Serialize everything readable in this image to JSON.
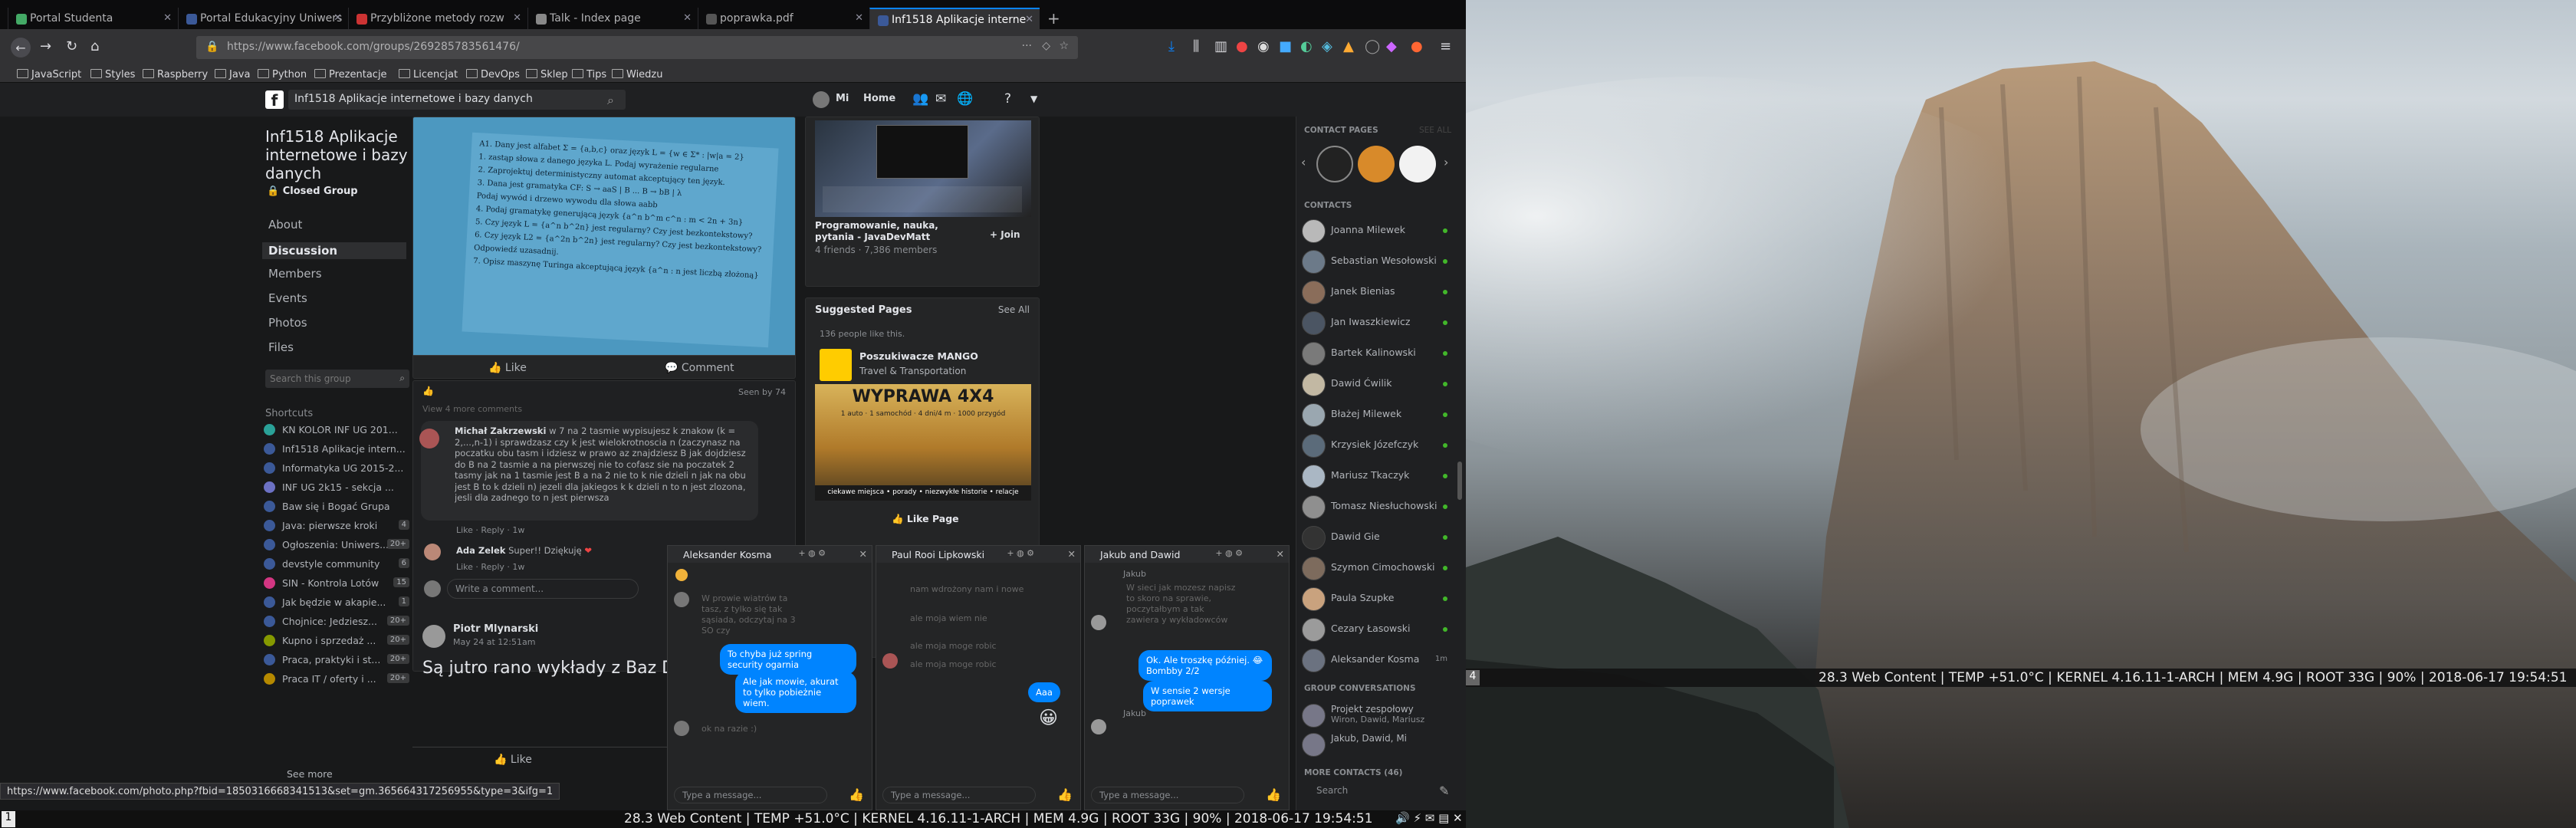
{
  "browser": {
    "tabs": [
      {
        "label": "Portal Studenta",
        "active": false
      },
      {
        "label": "Portal Edukacyjny Uniwers",
        "active": false
      },
      {
        "label": "Przybliżone metody rozw",
        "active": false
      },
      {
        "label": "Talk - Index page",
        "active": false
      },
      {
        "label": "poprawka.pdf",
        "active": false
      },
      {
        "label": "Inf1518 Aplikacje interne",
        "active": true
      }
    ],
    "new_tab": "+",
    "url": "https://www.facebook.com/groups/269285783561476/",
    "bookmarks": [
      "JavaScript",
      "Styles",
      "Raspberry",
      "Java",
      "Python",
      "Prezentacje",
      "Licencjat",
      "DevOps",
      "Sklep",
      "Tips",
      "Wiedzu"
    ],
    "hover_url": "https://www.facebook.com/photo.php?fbid=1850316668341513&set=gm.365664317256955&type=3&ifg=1"
  },
  "fb_top": {
    "group_name": "Inf1518 Aplikacje internetowe i bazy danych",
    "user": "Mi",
    "home": "Home"
  },
  "group": {
    "title": "Inf1518 Aplikacje internetowe i bazy danych",
    "privacy": "Closed Group",
    "nav": [
      "About",
      "Discussion",
      "Members",
      "Events",
      "Photos",
      "Files"
    ],
    "search_placeholder": "Search this group",
    "shortcuts_title": "Shortcuts",
    "shortcuts": [
      {
        "label": "KN KOLOR INF UG 201...",
        "badge": ""
      },
      {
        "label": "Inf1518 Aplikacje intern...",
        "badge": ""
      },
      {
        "label": "Informatyka UG 2015-2...",
        "badge": ""
      },
      {
        "label": "INF UG 2k15 - sekcja ...",
        "badge": ""
      },
      {
        "label": "Baw się i Bogać Grupa",
        "badge": ""
      },
      {
        "label": "Java: pierwsze kroki",
        "badge": "4"
      },
      {
        "label": "Ogłoszenia: Uniwers...",
        "badge": "20+"
      },
      {
        "label": "devstyle community",
        "badge": "6"
      },
      {
        "label": "SIN - Kontrola Lotów",
        "badge": "15"
      },
      {
        "label": "Jak będzie w akapie...",
        "badge": "1"
      },
      {
        "label": "Chojnice: Jedziesz...",
        "badge": "20+"
      },
      {
        "label": "Kupno i sprzedaż ...",
        "badge": "20+"
      },
      {
        "label": "Praca, praktyki i st...",
        "badge": "20+"
      },
      {
        "label": "Praca IT / oferty i ...",
        "badge": "20+"
      }
    ],
    "see_more": "See more"
  },
  "post": {
    "like_label": "Like",
    "comment_label": "Comment",
    "seen_by": "Seen by 74",
    "view_comments": "View 4 more comments",
    "comment1_author": "Michał Zakrzewski",
    "comment1_text": "w 7 na 2 tasmie wypisujesz k znakow (k = 2,...,n-1) i sprawdzasz czy k jest wielokrotnoscia n (zaczynasz na poczatku obu tasm i idziesz w prawo az znajdziesz B jak dojdziesz do B na 2 tasmie a na pierwszej nie to cofasz sie na poczatek 2 tasmy jak na 1 tasmie jest B a na 2 nie to k nie dzieli n jak na obu jest B to k dzieli n) jezeli dla jakiegos k k dzieli n to n jest zlozona, jesli dla zadnego to n jest pierwsza",
    "comment1_actions": "Like · Reply · 1w",
    "comment2_author": "Ada Zelek",
    "comment2_text": "Super!! Dziękuję",
    "comment2_actions": "Like · Reply · 1w",
    "write_comment": "Write a comment...",
    "post2_author": "Piotr Mlynarski",
    "post2_date": "May 24 at 12:51am",
    "post2_text": "Są jutro rano wykłady z Baz D",
    "post2_like": "Like"
  },
  "worksheet_lines": [
    "A1. Dany jest alfabet Σ = {a,b,c} oraz język L = {w ∈ Σ* : |w|a = 2}",
    "1. zastąp słowa z danego języka L. Podaj wyrażenie regularne",
    "2. Zaprojektuj deterministyczny automat akceptujący ten język.",
    "3. Dana jest gramatyka CF: S → aaS | B ... B → bB | λ",
    "Podaj wywód i drzewo wywodu dla słowa aabb",
    "4. Podaj gramatykę generującą język {a^n b^m c^n : m < 2n + 3n}",
    "5. Czy język L = {a^n b^2n} jest regularny? Czy jest bezkontekstowy?",
    "6. Czy język L2 = {a^2n b^2n} jest regularny? Czy jest bezkontekstowy?",
    "Odpowiedź uzasadnij.",
    "7. Opisz maszynę Turinga akceptującą język {a^n : n jest liczbą złożoną}"
  ],
  "right_col": {
    "page_name": "Programowanie, nauka, pytania - JavaDevMatt",
    "page_meta": "4 friends · 7,386 members",
    "join": "Join",
    "suggested_title": "Suggested Pages",
    "see_all": "See All",
    "likes_count": "136 people like this.",
    "suggested_page_name": "Poszukiwacze MANGO",
    "suggested_page_cat": "Travel & Transportation",
    "ad_title": "WYPRAWA 4X4",
    "ad_sub": "1 auto · 1 samochód · 4 dni/4 m · 1000 przygód",
    "ad_footer": "ciekawe miejsca • porady • niezwykłe historie • relacje",
    "like_page": "Like Page"
  },
  "contacts": {
    "pages_title": "CONTACT PAGES",
    "see_all": "SEE ALL",
    "contacts_title": "CONTACTS",
    "list": [
      {
        "name": "Joanna Milewek",
        "status": "online"
      },
      {
        "name": "Sebastian Wesołowski",
        "status": "online"
      },
      {
        "name": "Janek Bienias",
        "status": "online"
      },
      {
        "name": "Jan Iwaszkiewicz",
        "status": "online"
      },
      {
        "name": "Bartek Kalinowski",
        "status": "online"
      },
      {
        "name": "Dawid Ćwilik",
        "status": "online"
      },
      {
        "name": "Błażej Milewek",
        "status": "online"
      },
      {
        "name": "Krzysiek Józefczyk",
        "status": "online"
      },
      {
        "name": "Mariusz Tkaczyk",
        "status": "online"
      },
      {
        "name": "Tomasz Niesłuchowski",
        "status": "online"
      },
      {
        "name": "Dawid Gie",
        "status": "online"
      },
      {
        "name": "Szymon Cimochowski",
        "status": "online"
      },
      {
        "name": "Paula Szupke",
        "status": "online"
      },
      {
        "name": "Cezary Łasowski",
        "status": "online"
      },
      {
        "name": "Aleksander Kosma",
        "status": "1m"
      }
    ],
    "group_conv_title": "GROUP CONVERSATIONS",
    "groups": [
      {
        "name": "Projekt zespołowy",
        "sub": "Wiron, Dawid, Mariusz"
      },
      {
        "name": "Jakub, Dawid, Mi",
        "sub": ""
      }
    ],
    "more_contacts": "MORE CONTACTS (46)",
    "search": "Search"
  },
  "chats": [
    {
      "name": "Aleksander Kosma",
      "incoming_faded": "W prowie wiatrów ta tasz, z tylko się tak sąsiada, odczytaj na 3 SO czy",
      "outgoing": [
        "To chyba już spring security ogarnia",
        "Ale jak mowie, akurat to tylko pobieżnie wiem."
      ],
      "faded_last": "ok na razie :)",
      "input": "Type a message..."
    },
    {
      "name": "Paul Rooi Lipkowski",
      "incoming_faded": [
        "nam wdrożony nam i nowe",
        "ale moja wiem nie"
      ],
      "mid_faded": [
        "ale moja moge robic",
        "ale moja moge robic"
      ],
      "outgoing": [
        "Aaa"
      ],
      "input": "Type a message..."
    },
    {
      "name": "Jakub and Dawid",
      "sender_top": "Jakub",
      "incoming_faded": "W sieci jak mozesz napisz to skoro na sprawie, poczytałbym a tak zawiera y wykładowców",
      "outgoing": [
        "Ok. Ale troszkę później. 😂 Bombby 2/2",
        "W sensie 2 wersje poprawek"
      ],
      "sender_bottom": "Jakub",
      "input": "Type a message..."
    }
  ],
  "status_bar": {
    "text": "28.3 Web Content | TEMP +51.0°C | KERNEL 4.16.11-1-ARCH | MEM 4.9G | ROOT 33G | 90% | 2018-06-17 19:54:51",
    "workspace": "1"
  },
  "desktop_status": {
    "workspace": "4",
    "text": "28.3 Web Content | TEMP +51.0°C | KERNEL 4.16.11-1-ARCH | MEM 4.9G | ROOT 33G | 90% | 2018-06-17 19:54:51"
  }
}
